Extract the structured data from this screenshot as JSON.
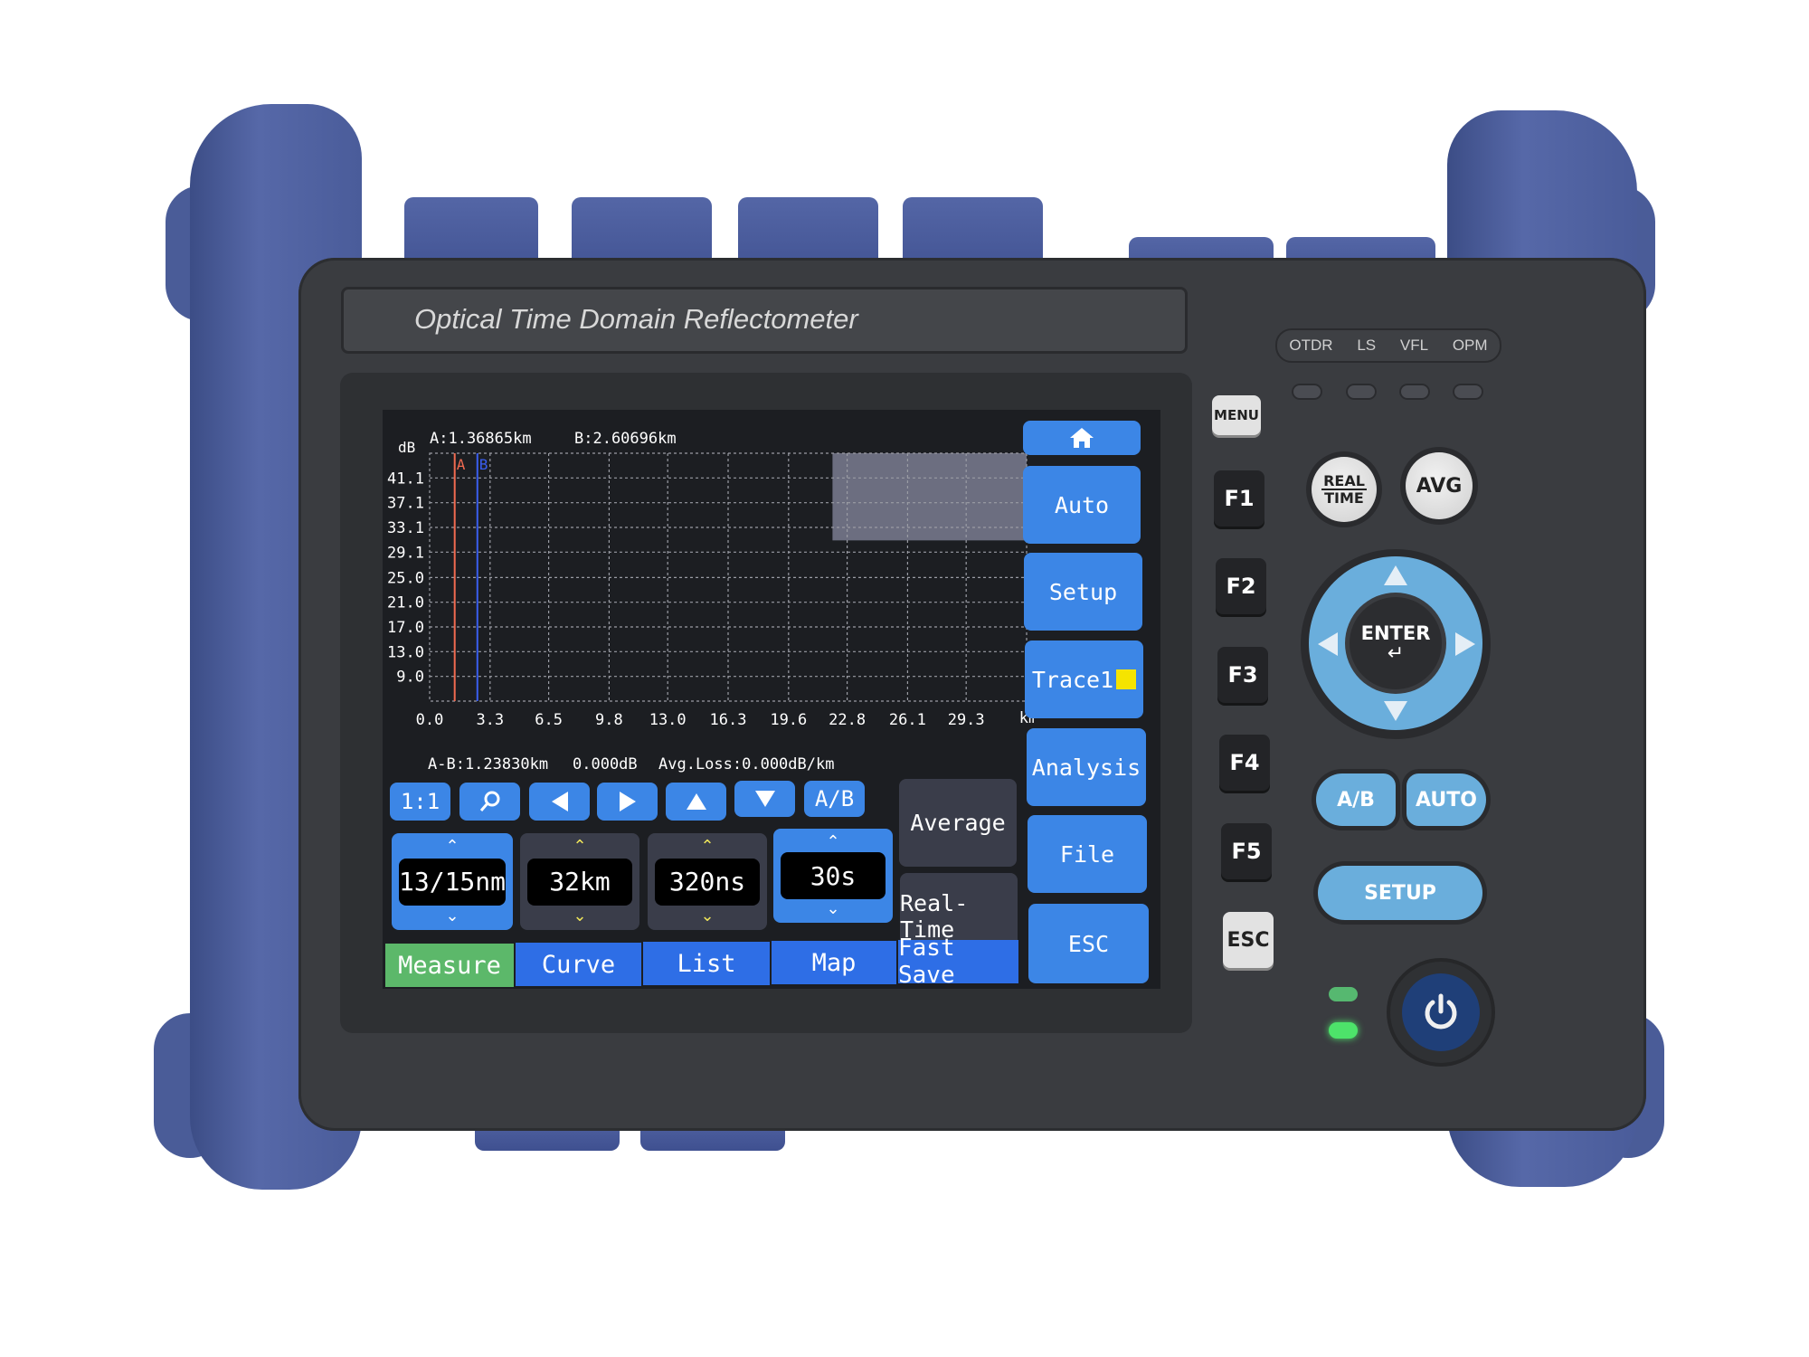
{
  "device": {
    "title": "Optical Time Domain Reflectometer",
    "mode_labels": [
      "OTDR",
      "LS",
      "VFL",
      "OPM"
    ],
    "colors": {
      "bumper": "#4a5c9a",
      "panel": "#3a3c40",
      "screen_bg": "#1c1e22",
      "ui_blue": "#3c86e6",
      "tab_blue": "#2e6ee6",
      "active_green": "#5cb86a",
      "keypad_blue": "#6aaedc",
      "marker_a": "#f06a50",
      "marker_b": "#3a5ef0",
      "trace_swatch": "#f5e400",
      "led_green": "#4de36a"
    }
  },
  "screen": {
    "cursor_readout": {
      "a": "A:1.36865km",
      "b": "B:2.60696km"
    },
    "marker_labels": {
      "a": "A",
      "b": "B"
    },
    "summary": {
      "distance": "A-B:1.23830km",
      "loss": "0.000dB",
      "avg_loss": "Avg.Loss:0.000dB/km"
    },
    "toolbar": [
      {
        "name": "zoom-1-1-button",
        "label": "1:1",
        "icon": null
      },
      {
        "name": "zoom-button",
        "label": "",
        "icon": "magnifier-icon"
      },
      {
        "name": "pan-left-button",
        "label": "",
        "icon": "triangle-left-icon"
      },
      {
        "name": "pan-right-button",
        "label": "",
        "icon": "triangle-right-icon"
      },
      {
        "name": "pan-up-button",
        "label": "",
        "icon": "triangle-up-icon"
      },
      {
        "name": "pan-down-button",
        "label": "",
        "icon": "triangle-down-icon"
      },
      {
        "name": "ab-toggle-button",
        "label": "A/B",
        "icon": null
      }
    ],
    "mode_buttons": {
      "average": "Average",
      "realtime": "Real-Time"
    },
    "params": [
      {
        "name": "wavelength",
        "value": "13/15nm",
        "style": "blue"
      },
      {
        "name": "range",
        "value": "32km",
        "style": "gray"
      },
      {
        "name": "pulse-width",
        "value": "320ns",
        "style": "gray"
      },
      {
        "name": "duration",
        "value": "30s",
        "style": "blue"
      }
    ],
    "tabs": [
      {
        "label": "Measure",
        "active": true
      },
      {
        "label": "Curve",
        "active": false
      },
      {
        "label": "List",
        "active": false
      },
      {
        "label": "Map",
        "active": false
      },
      {
        "label": "Fast Save",
        "active": false
      }
    ],
    "side_menu": [
      {
        "label": "",
        "icon": "home-icon"
      },
      {
        "label": "Auto"
      },
      {
        "label": "Setup"
      },
      {
        "label": "Trace1"
      },
      {
        "label": "Analysis"
      },
      {
        "label": "File"
      },
      {
        "label": "ESC"
      }
    ]
  },
  "chart_data": {
    "type": "line",
    "title": "",
    "xlabel": "km",
    "ylabel": "dB",
    "x_ticks": [
      "0.0",
      "3.3",
      "6.5",
      "9.8",
      "13.0",
      "16.3",
      "19.6",
      "22.8",
      "26.1",
      "29.3"
    ],
    "y_ticks": [
      "41.1",
      "37.1",
      "33.1",
      "29.1",
      "25.0",
      "21.0",
      "17.0",
      "13.0",
      "9.0"
    ],
    "xlim": [
      0,
      32.6
    ],
    "ylim": [
      5.0,
      45.1
    ],
    "grid": true,
    "series": [],
    "markers": [
      {
        "name": "A",
        "x_km": 1.36865,
        "color": "#f06a50"
      },
      {
        "name": "B",
        "x_km": 2.60696,
        "color": "#3a5ef0"
      }
    ],
    "overlay_box": {
      "x_range_km": [
        22.0,
        32.6
      ],
      "y_range_db": [
        31.0,
        45.1
      ],
      "color": "#6c6e80"
    }
  },
  "keypad": {
    "menu": "MENU",
    "fkeys": [
      "F1",
      "F2",
      "F3",
      "F4",
      "F5"
    ],
    "esc": "ESC",
    "realtime_top": "REAL",
    "realtime_bottom": "TIME",
    "avg": "AVG",
    "enter": "ENTER",
    "enter_glyph": "↵",
    "ab": "A/B",
    "auto": "AUTO",
    "setup": "SETUP",
    "power_glyph": "⏻"
  }
}
